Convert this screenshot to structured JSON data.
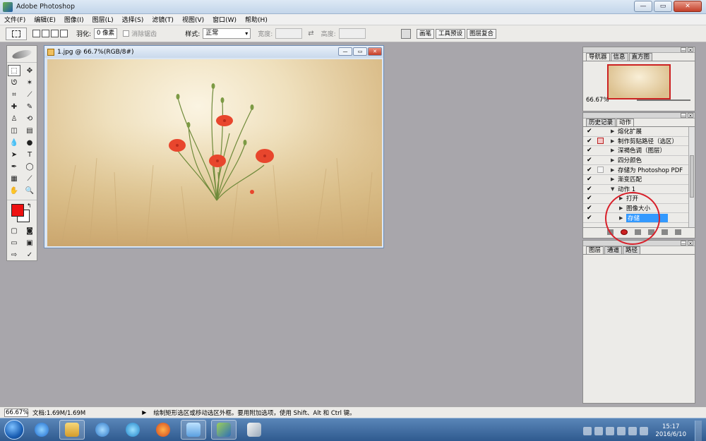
{
  "app": {
    "title": "Adobe Photoshop"
  },
  "menu": [
    "文件(F)",
    "编辑(E)",
    "图像(I)",
    "图层(L)",
    "选择(S)",
    "滤镜(T)",
    "视图(V)",
    "窗口(W)",
    "帮助(H)"
  ],
  "options": {
    "feather_label": "羽化:",
    "feather_value": "0 像素",
    "antialias_label": "消除锯齿",
    "style_label": "样式:",
    "style_value": "正常",
    "width_label": "宽度:",
    "height_label": "高度:",
    "swap_icon": "⇄"
  },
  "well": {
    "tabs": [
      "画笔",
      "工具预设",
      "图层复合"
    ]
  },
  "document": {
    "title": "1.jpg @ 66.7%(RGB/8#)"
  },
  "navigator": {
    "tabs": [
      "导航器",
      "信息",
      "直方图"
    ],
    "zoom": "66.67%"
  },
  "actions": {
    "tabs": [
      "历史记录",
      "动作"
    ],
    "rows": [
      {
        "check": "✔",
        "dialog": "none",
        "indent": "l1",
        "expander": "▶",
        "label": "熔化扩展"
      },
      {
        "check": "✔",
        "dialog": "red",
        "indent": "l1",
        "expander": "▶",
        "label": "制作剪贴路径（选区）"
      },
      {
        "check": "✔",
        "dialog": "none",
        "indent": "l1",
        "expander": "▶",
        "label": "深褐色调（图层）"
      },
      {
        "check": "✔",
        "dialog": "none",
        "indent": "l1",
        "expander": "▶",
        "label": "四分颜色"
      },
      {
        "check": "✔",
        "dialog": "box",
        "indent": "l1",
        "expander": "▶",
        "label": "存储为 Photoshop PDF"
      },
      {
        "check": "✔",
        "dialog": "none",
        "indent": "l1",
        "expander": "▶",
        "label": "渐变匹配"
      },
      {
        "check": "✔",
        "dialog": "none",
        "indent": "l1",
        "expander": "▼",
        "label": "动作 1"
      },
      {
        "check": "✔",
        "dialog": "none",
        "indent": "l2",
        "expander": "▶",
        "label": "打开"
      },
      {
        "check": "✔",
        "dialog": "none",
        "indent": "l2",
        "expander": "▶",
        "label": "图像大小"
      },
      {
        "check": "✔",
        "dialog": "none",
        "indent": "l2",
        "expander": "▶",
        "label": "存储",
        "selected": true
      }
    ]
  },
  "layers": {
    "tabs": [
      "图层",
      "通道",
      "路径"
    ]
  },
  "status": {
    "zoom": "66.67%",
    "doc_size": "文档:1.69M/1.69M",
    "play_icon": "▶",
    "hint": "绘制矩形选区或移动选区外框。要用附加选项，使用 Shift、Alt 和 Ctrl 键。"
  },
  "taskbar": {
    "time": "15:17",
    "date": "2016/6/10"
  },
  "colors": {
    "foreground": "#ee1111",
    "background": "#ffffff",
    "selection": "#3399ff",
    "annotation": "#d8202a"
  }
}
